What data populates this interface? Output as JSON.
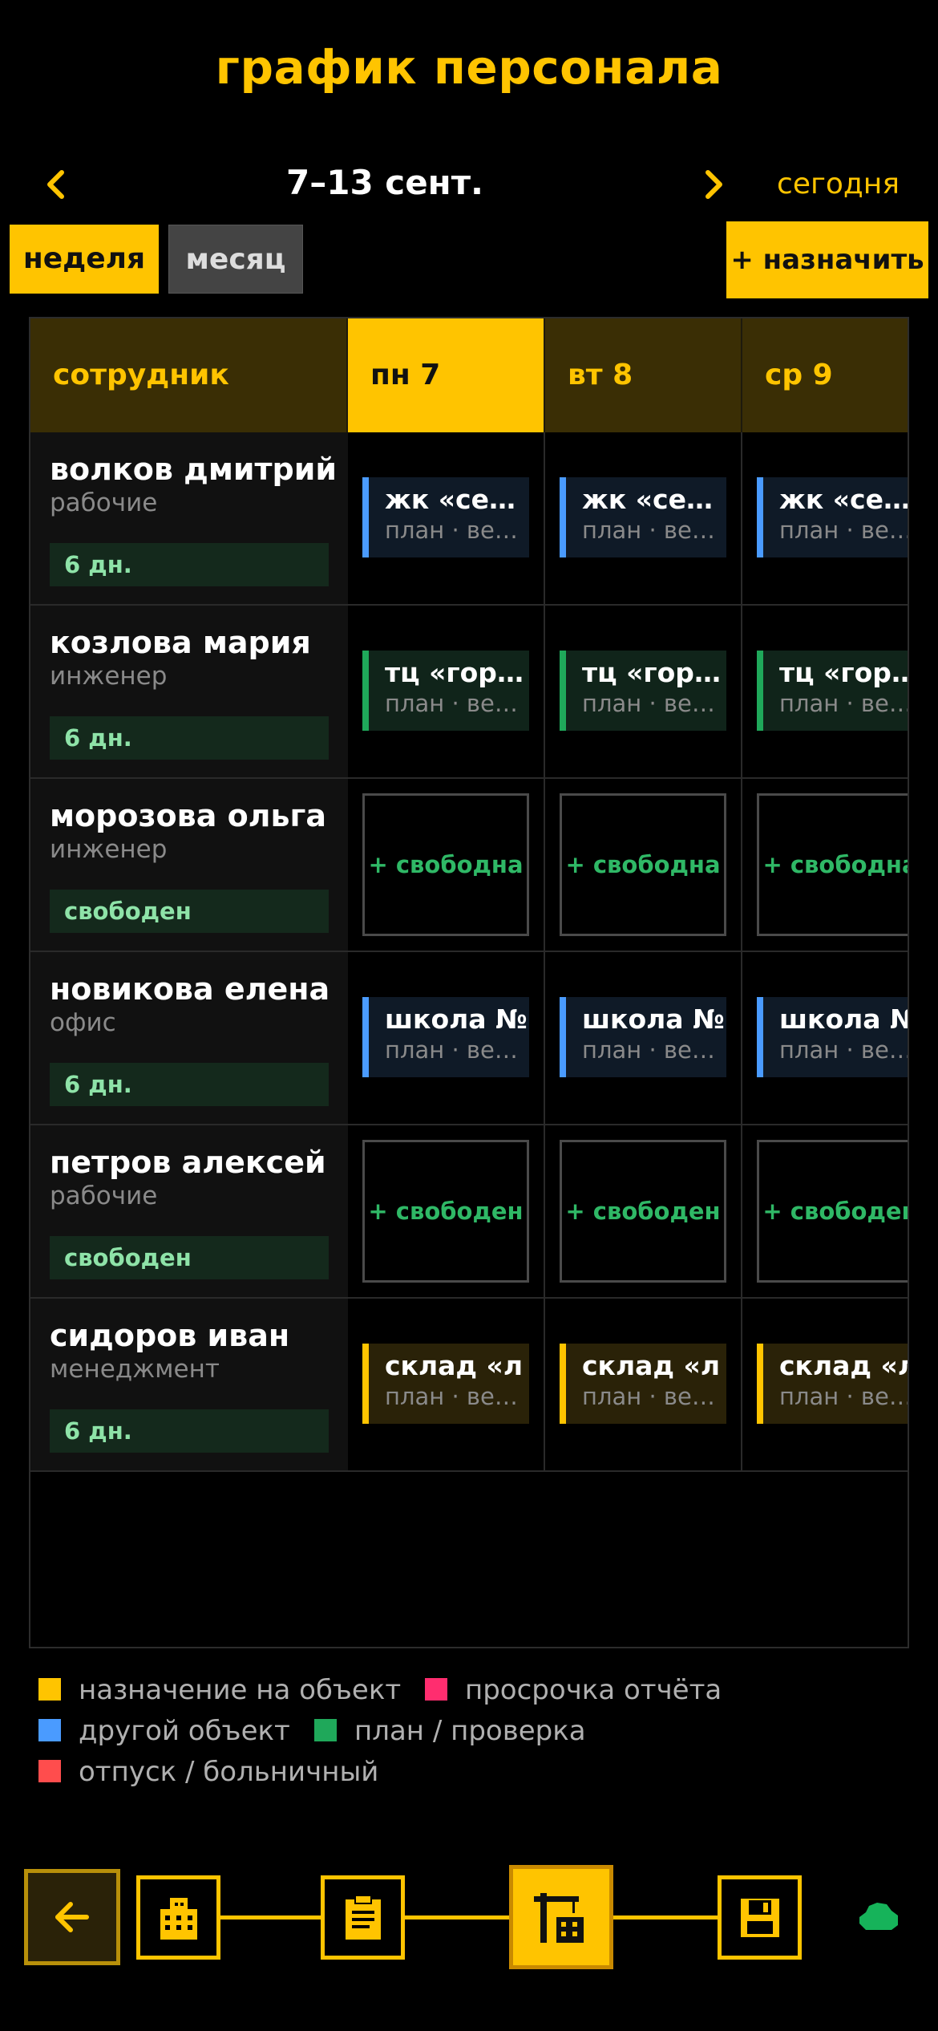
{
  "title": "график персонала",
  "nav": {
    "range": "7–13 сент.",
    "today": "сегодня"
  },
  "views": {
    "week": "неделя",
    "month": "месяц",
    "assign": "+ назначить"
  },
  "table": {
    "emp_header": "сотрудник",
    "days": [
      "пн 7",
      "вт 8",
      "ср 9"
    ],
    "rows": [
      {
        "name": "волков дмитрий",
        "role": "рабочие",
        "badge": "6 дн.",
        "cells": [
          {
            "type": "assign",
            "color": "blue",
            "l1": "жк «северный»",
            "l2": "план · весь день"
          },
          {
            "type": "assign",
            "color": "blue",
            "l1": "жк «северный»",
            "l2": "план · весь день"
          },
          {
            "type": "assign",
            "color": "blue",
            "l1": "жк «северный»",
            "l2": "план · весь день"
          }
        ]
      },
      {
        "name": "козлова мария",
        "role": "инженер",
        "badge": "6 дн.",
        "cells": [
          {
            "type": "assign",
            "color": "green",
            "l1": "тц «город»",
            "l2": "план · весь день"
          },
          {
            "type": "assign",
            "color": "green",
            "l1": "тц «город»",
            "l2": "план · весь день"
          },
          {
            "type": "assign",
            "color": "green",
            "l1": "тц «город»",
            "l2": "план · весь день"
          }
        ]
      },
      {
        "name": "морозова ольга",
        "role": "инженер",
        "badge": "свободен",
        "cells": [
          {
            "type": "free",
            "l1": "+ свободна"
          },
          {
            "type": "free",
            "l1": "+ свободна"
          },
          {
            "type": "free",
            "l1": "+ свободна"
          }
        ]
      },
      {
        "name": "новикова елена",
        "role": "офис",
        "badge": "6 дн.",
        "cells": [
          {
            "type": "assign",
            "color": "blue",
            "l1": "школа №",
            "l2": "план · весь день"
          },
          {
            "type": "assign",
            "color": "blue",
            "l1": "школа №",
            "l2": "план · весь день"
          },
          {
            "type": "assign",
            "color": "blue",
            "l1": "школа №",
            "l2": "план · весь день"
          }
        ]
      },
      {
        "name": "петров алексей",
        "role": "рабочие",
        "badge": "свободен",
        "cells": [
          {
            "type": "free",
            "l1": "+ свободен"
          },
          {
            "type": "free",
            "l1": "+ свободен"
          },
          {
            "type": "free",
            "l1": "+ свободен"
          }
        ]
      },
      {
        "name": "сидоров иван",
        "role": "менеджмент",
        "badge": "6 дн.",
        "cells": [
          {
            "type": "assign",
            "color": "yellow",
            "l1": "склад «л",
            "l2": "план · весь день"
          },
          {
            "type": "assign",
            "color": "yellow",
            "l1": "склад «л",
            "l2": "план · весь день"
          },
          {
            "type": "assign",
            "color": "yellow",
            "l1": "склад «л",
            "l2": "план · весь день"
          }
        ]
      }
    ]
  },
  "legend": [
    {
      "label": "назначение на объект",
      "color": "#ffc400"
    },
    {
      "label": "просрочка отчёта",
      "color": "#ff2d6f"
    },
    {
      "label": "другой объект",
      "color": "#4a9bff"
    },
    {
      "label": "план / проверка",
      "color": "#1fa85a"
    },
    {
      "label": "отпуск / больничный",
      "color": "#ff4d4d"
    }
  ],
  "bottom_nav": [
    "back-icon",
    "building-icon",
    "clipboard-icon",
    "crane-icon",
    "save-icon",
    "cloud-icon"
  ],
  "colors": {
    "accent": "#ffc400",
    "green": "#1fa85a",
    "blue": "#4a9bff"
  }
}
